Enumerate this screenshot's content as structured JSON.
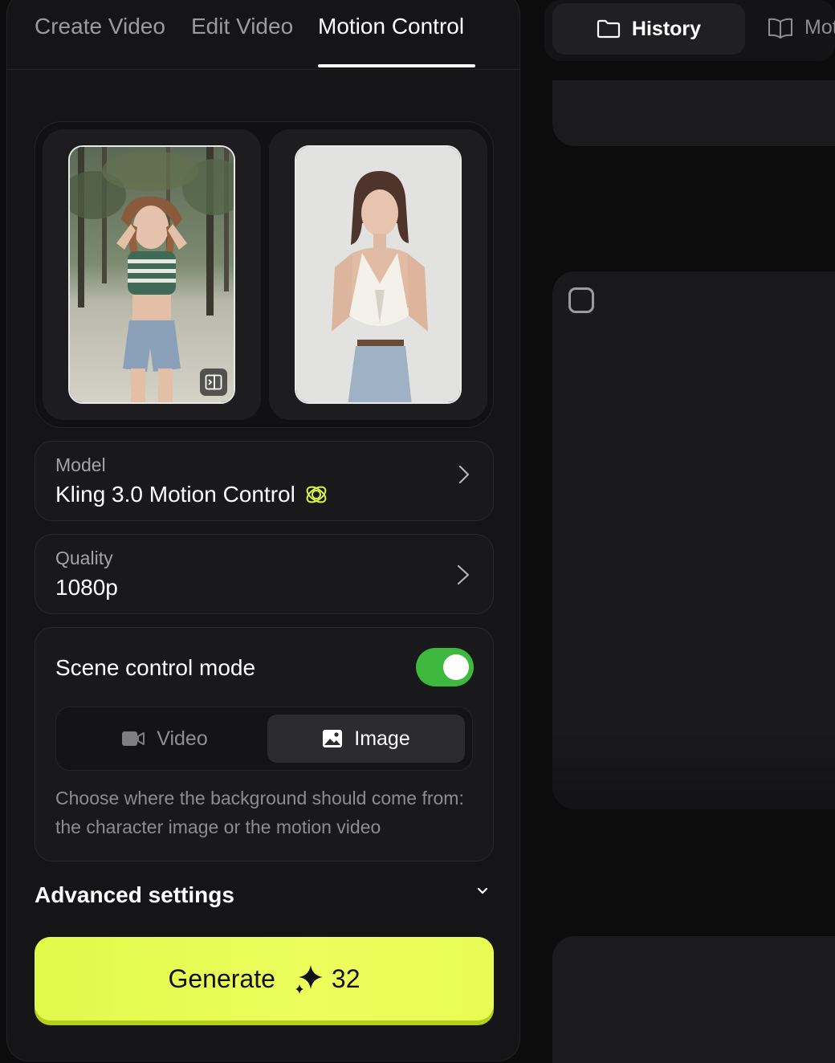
{
  "tabs": {
    "create_video": "Create Video",
    "edit_video": "Edit Video",
    "motion_control": "Motion Control",
    "active": "motion_control"
  },
  "model": {
    "label": "Model",
    "value": "Kling 3.0 Motion Control",
    "icon": "kling-orbit-icon"
  },
  "quality": {
    "label": "Quality",
    "value": "1080p"
  },
  "scene_control": {
    "title": "Scene control mode",
    "enabled": true,
    "options": [
      "Video",
      "Image"
    ],
    "video_label": "Video",
    "image_label": "Image",
    "selected": "Image",
    "description": "Choose where the background should come from: the character image or the motion video"
  },
  "advanced": {
    "label": "Advanced settings"
  },
  "generate": {
    "label": "Generate",
    "credits": "32",
    "color": "#e6fb52"
  },
  "right_panel": {
    "history_label": "History",
    "second_tab_label": "Mot"
  },
  "colors": {
    "accent": "#e6fb52",
    "toggle_on": "#3fb83f",
    "panel_bg": "#151517"
  }
}
